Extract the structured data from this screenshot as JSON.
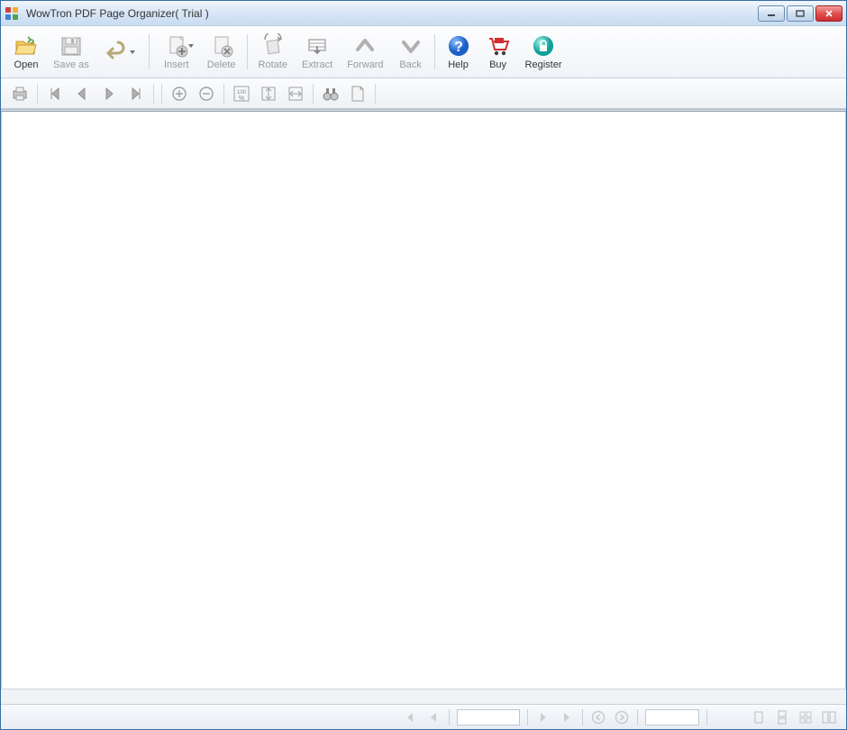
{
  "window": {
    "title": "WowTron PDF Page Organizer( Trial )"
  },
  "toolbar": {
    "open": "Open",
    "save_as": "Save as",
    "insert": "Insert",
    "delete": "Delete",
    "rotate": "Rotate",
    "extract": "Extract",
    "forward": "Forward",
    "back": "Back",
    "help": "Help",
    "buy": "Buy",
    "register": "Register"
  },
  "sub": {
    "zoom_label": "100%"
  }
}
